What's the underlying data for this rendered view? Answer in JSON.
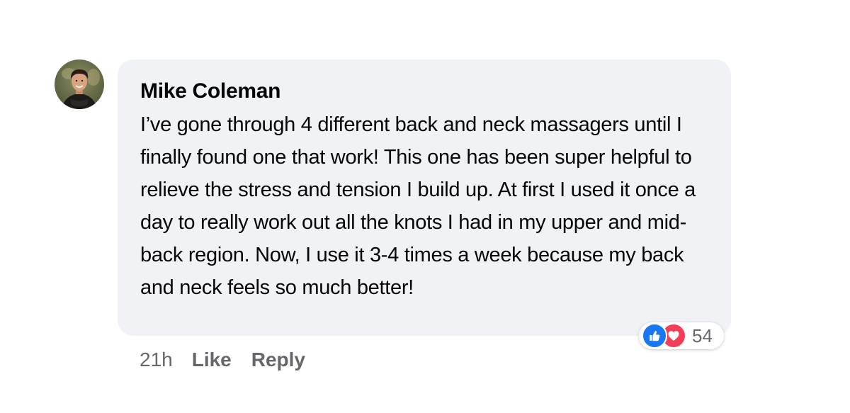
{
  "comment": {
    "author": "Mike Coleman",
    "text": "I’ve gone through 4 different back and neck massagers until I finally found one that work! This one has been super helpful to relieve the stress and tension I build up. At first I used it once a day to really work out all the knots I had in my upper and mid-back region. Now, I use it 3-4 times a week because my back and neck feels so much better!",
    "timestamp": "21h",
    "like_label": "Like",
    "reply_label": "Reply"
  },
  "reactions": {
    "icons": [
      "like-icon",
      "love-icon"
    ],
    "count": "54"
  },
  "colors": {
    "bubble": "#f0f2f5",
    "text": "#050505",
    "meta": "#65676b",
    "like": "#1877f2",
    "love": "#f33e58"
  }
}
